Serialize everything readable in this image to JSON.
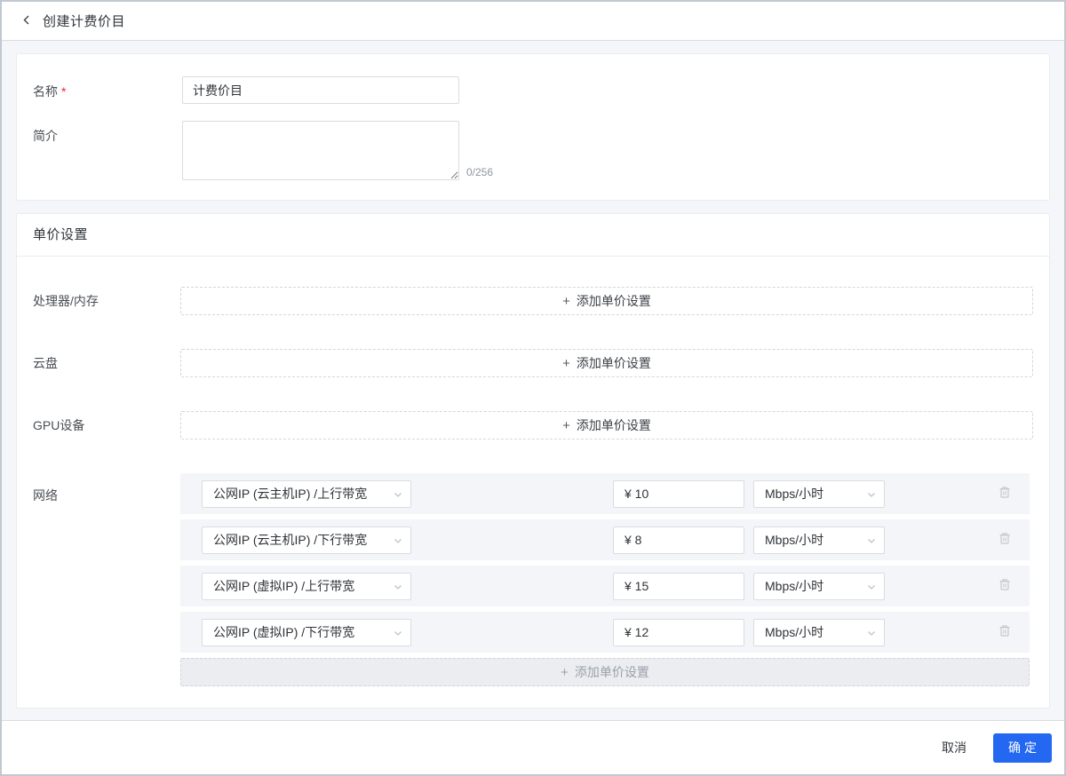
{
  "header": {
    "title": "创建计费价目"
  },
  "form": {
    "name": {
      "label": "名称",
      "required_mark": "*",
      "value": "计费价目"
    },
    "intro": {
      "label": "简介",
      "value": "",
      "counter": "0/256"
    }
  },
  "pricing": {
    "section_title": "单价设置",
    "plus": "+",
    "add_label": "添加单价设置",
    "categories": [
      {
        "label": "处理器/内存"
      },
      {
        "label": "云盘"
      },
      {
        "label": "GPU设备"
      }
    ],
    "network": {
      "label": "网络",
      "entries": [
        {
          "type": "公网IP (云主机IP) /上行带宽",
          "price": "¥ 10",
          "unit": "Mbps/小时"
        },
        {
          "type": "公网IP (云主机IP) /下行带宽",
          "price": "¥ 8",
          "unit": "Mbps/小时"
        },
        {
          "type": "公网IP (虚拟IP) /上行带宽",
          "price": "¥ 15",
          "unit": "Mbps/小时"
        },
        {
          "type": "公网IP (虚拟IP) /下行带宽",
          "price": "¥ 12",
          "unit": "Mbps/小时"
        }
      ]
    }
  },
  "footer": {
    "cancel_label": "取消",
    "confirm_label": "确定"
  },
  "colors": {
    "primary": "#2468f2",
    "required": "#f5222d",
    "page_bg": "#f5f6f9",
    "band_bg": "#f4f5f8",
    "border": "#d9dce3"
  }
}
